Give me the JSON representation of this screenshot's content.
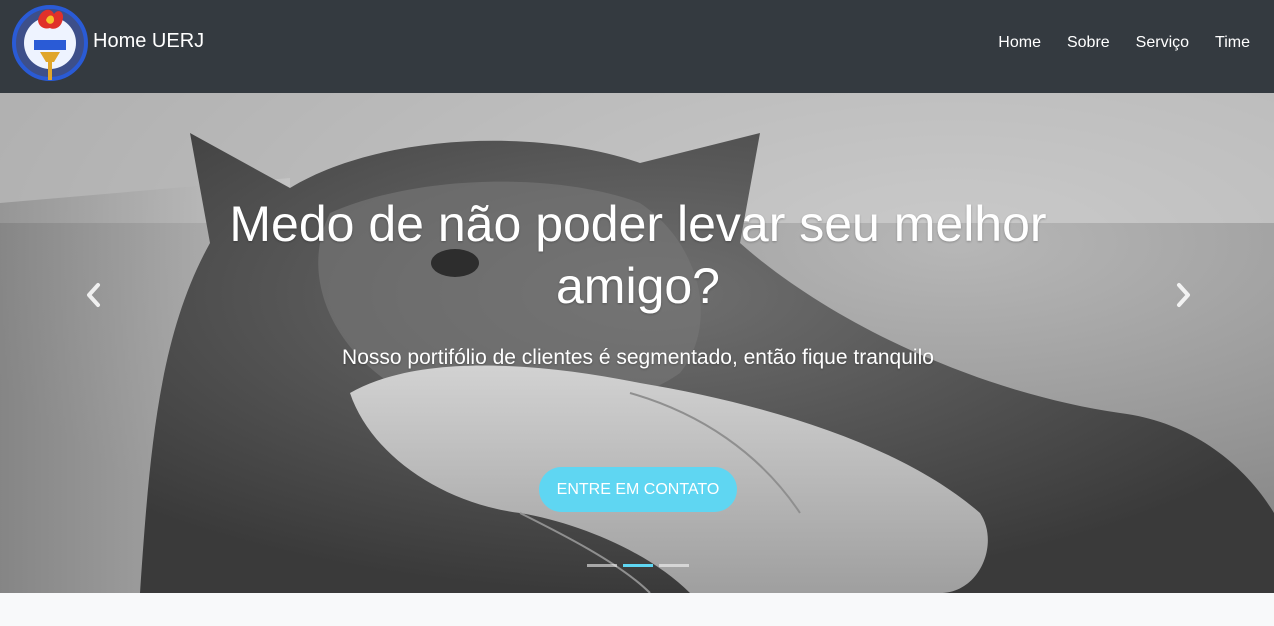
{
  "navbar": {
    "brand": "Home UERJ",
    "logo_icon": "uerj-seal-logo",
    "items": [
      {
        "label": "Home"
      },
      {
        "label": "Sobre"
      },
      {
        "label": "Serviço"
      },
      {
        "label": "Time"
      }
    ],
    "background": "#343a40"
  },
  "hero": {
    "headline": "Medo de não poder levar seu melhor amigo?",
    "subheadline": "Nosso portifólio de clientes é segmentado, então fique tranquilo",
    "cta_label": "ENTRE EM CONTATO",
    "cta_color": "#5fd6f2",
    "prev_icon": "chevron-left-icon",
    "next_icon": "chevron-right-icon",
    "slide_count": 3,
    "active_slide": 2
  }
}
